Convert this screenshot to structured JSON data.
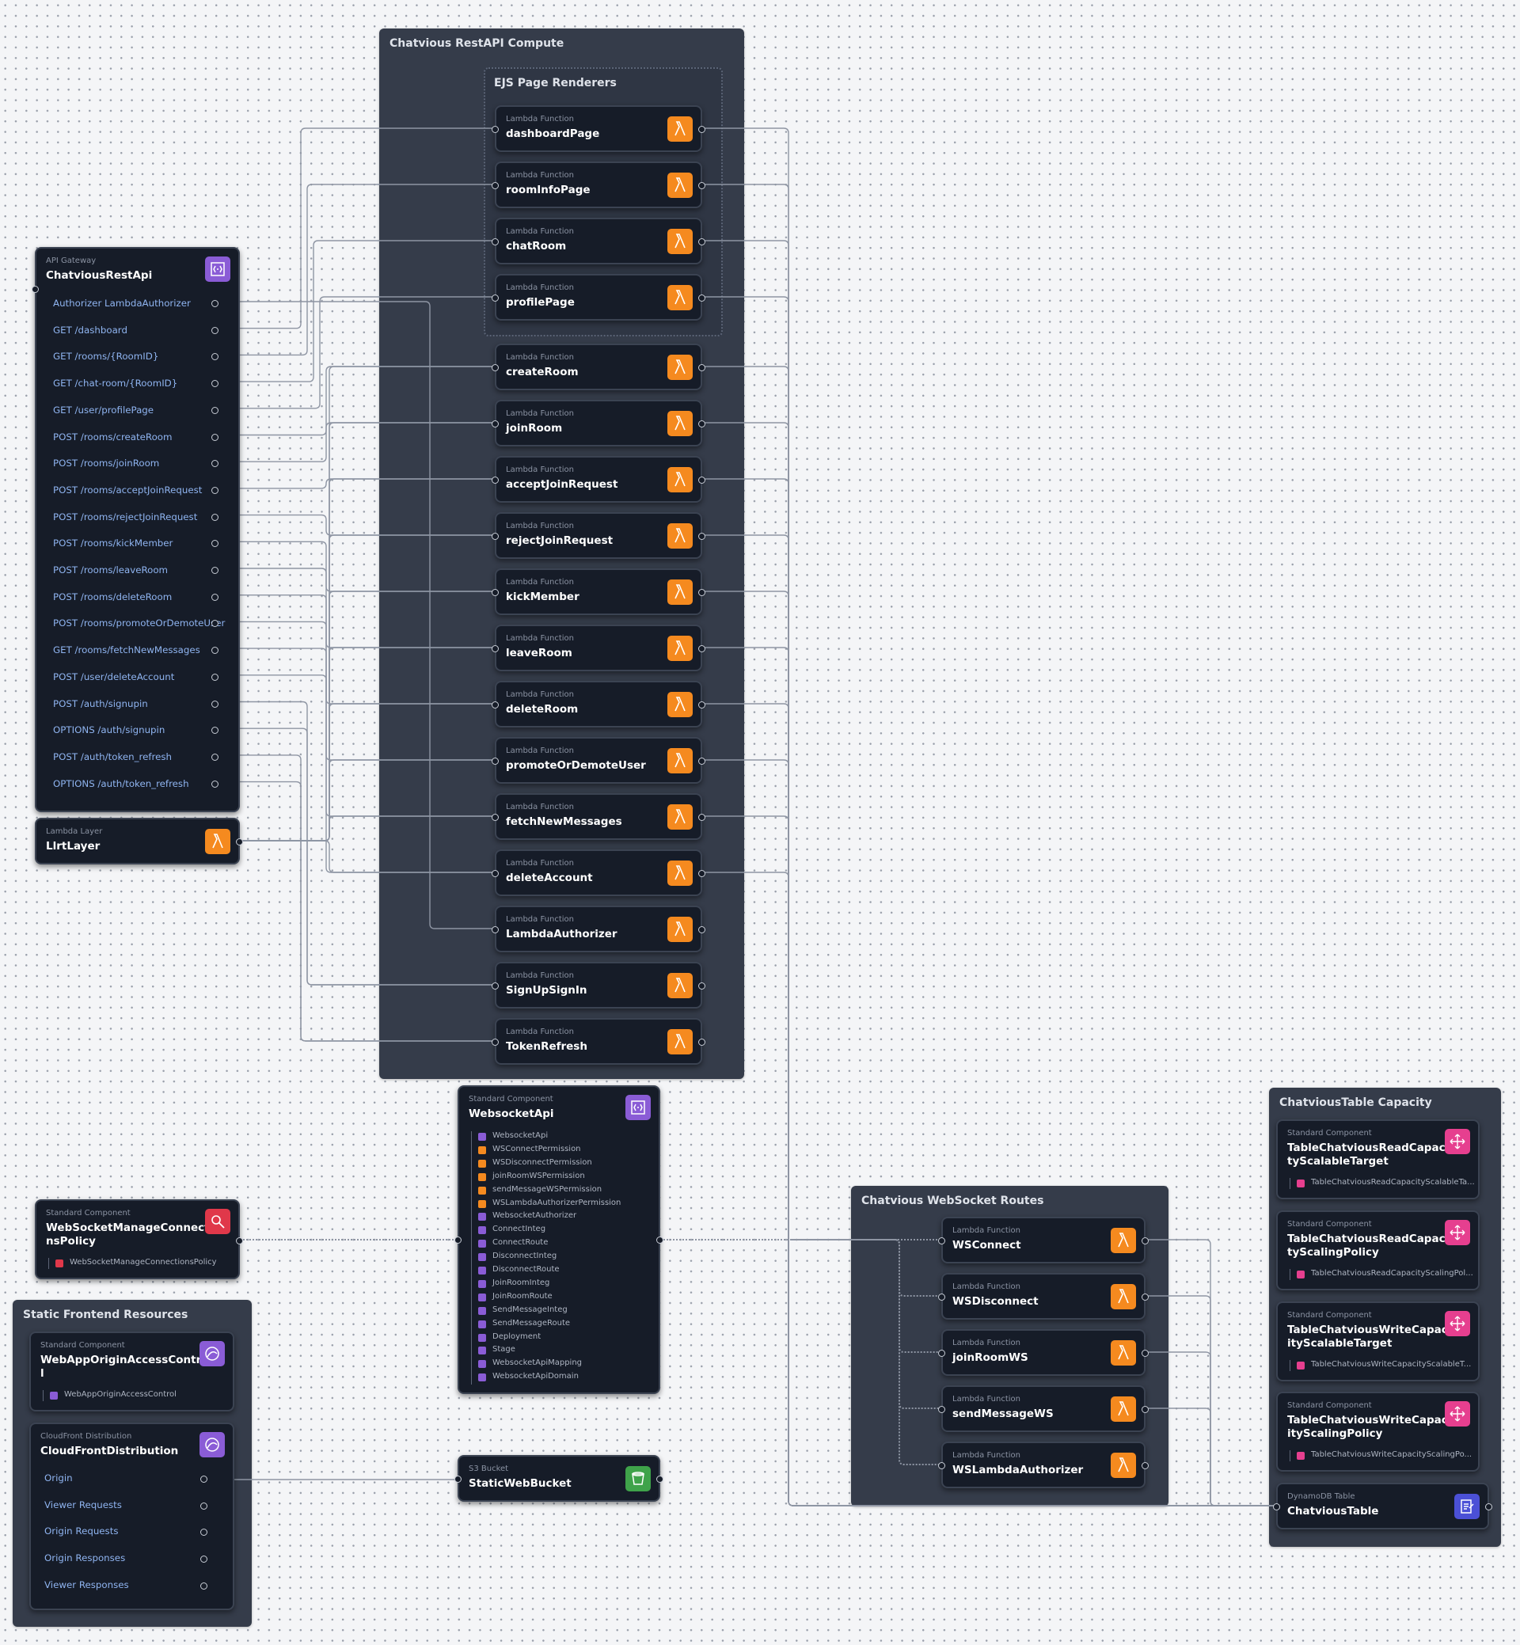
{
  "groups": {
    "restapi_compute": "Chatvious RestAPI Compute",
    "ejs_renderers": "EJS Page Renderers",
    "websocket_routes": "Chatvious WebSocket Routes",
    "table_capacity": "ChatviousTable Capacity",
    "static_frontend": "Static Frontend Resources"
  },
  "types": {
    "lambda_function": "Lambda Function",
    "api_gateway": "API Gateway",
    "lambda_layer": "Lambda Layer",
    "standard_component": "Standard Component",
    "cloudfront": "CloudFront Distribution",
    "s3_bucket": "S3 Bucket",
    "dynamodb": "DynamoDB Table"
  },
  "rest_api": {
    "name": "ChatviousRestApi",
    "routes": [
      "Authorizer LambdaAuthorizer",
      "GET /dashboard",
      "GET /rooms/{RoomID}",
      "GET /chat-room/{RoomID}",
      "GET /user/profilePage",
      "POST /rooms/createRoom",
      "POST /rooms/joinRoom",
      "POST /rooms/acceptJoinRequest",
      "POST /rooms/rejectJoinRequest",
      "POST /rooms/kickMember",
      "POST /rooms/leaveRoom",
      "POST /rooms/deleteRoom",
      "POST /rooms/promoteOrDemoteUser",
      "GET /rooms/fetchNewMessages",
      "POST /user/deleteAccount",
      "POST /auth/signupin",
      "OPTIONS /auth/signupin",
      "POST /auth/token_refresh",
      "OPTIONS /auth/token_refresh"
    ]
  },
  "lambda_layer": {
    "name": "LlrtLayer"
  },
  "ejs_functions": [
    "dashboardPage",
    "roomInfoPage",
    "chatRoom",
    "profilePage"
  ],
  "rest_functions": [
    "createRoom",
    "joinRoom",
    "acceptJoinRequest",
    "rejectJoinRequest",
    "kickMember",
    "leaveRoom",
    "deleteRoom",
    "promoteOrDemoteUser",
    "fetchNewMessages",
    "deleteAccount",
    "LambdaAuthorizer",
    "SignUpSignIn",
    "TokenRefresh"
  ],
  "websocket_api": {
    "name": "WebsocketApi",
    "items": [
      "WebsocketApi",
      "WSConnectPermission",
      "WSDisconnectPermission",
      "joinRoomWSPermission",
      "sendMessageWSPermission",
      "WSLambdaAuthorizerPermission",
      "WebsocketAuthorizer",
      "ConnectInteg",
      "ConnectRoute",
      "DisconnectInteg",
      "DisconnectRoute",
      "JoinRoomInteg",
      "JoinRoomRoute",
      "SendMessageInteg",
      "SendMessageRoute",
      "Deployment",
      "Stage",
      "WebsocketApiMapping",
      "WebsocketApiDomain"
    ],
    "item_kinds": [
      "apig",
      "lam",
      "lam",
      "lam",
      "lam",
      "lam",
      "apig",
      "apig",
      "apig",
      "apig",
      "apig",
      "apig",
      "apig",
      "apig",
      "apig",
      "apig",
      "apig",
      "apig",
      "apig"
    ]
  },
  "ws_manage_policy": {
    "name": "WebSocketManageConnectionsPolicy",
    "item": "WebSocketManageConnectionsPolicy"
  },
  "ws_functions": [
    "WSConnect",
    "WSDisconnect",
    "joinRoomWS",
    "sendMessageWS",
    "WSLambdaAuthorizer"
  ],
  "capacity": [
    {
      "name": "TableChatviousReadCapacityScalableTarget",
      "item": "TableChatviousReadCapacityScalableTa..."
    },
    {
      "name": "TableChatviousReadCapacityScalingPolicy",
      "item": "TableChatviousReadCapacityScalingPol..."
    },
    {
      "name": "TableChatviousWriteCapacityScalableTarget",
      "item": "TableChatviousWriteCapacityScalableT..."
    },
    {
      "name": "TableChatviousWriteCapacityScalingPolicy",
      "item": "TableChatviousWriteCapacityScalingPo..."
    }
  ],
  "dynamodb": {
    "name": "ChatviousTable"
  },
  "origin_access": {
    "name": "WebAppOriginAccessControl",
    "item": "WebAppOriginAccessControl"
  },
  "cloudfront": {
    "name": "CloudFrontDistribution",
    "items": [
      "Origin",
      "Viewer Requests",
      "Origin Requests",
      "Origin Responses",
      "Viewer Responses"
    ]
  },
  "s3": {
    "name": "StaticWebBucket"
  },
  "colors": {
    "lambda": "#f58a1f",
    "api_gateway": "#8a5cd6",
    "policy": "#e0384a",
    "autoscaling": "#e63f8f",
    "dynamodb": "#4b50d6",
    "s3": "#3fa34a",
    "route_text": "#8fb4f0",
    "group_bg": "#353c4a",
    "node_bg": "#161c28"
  },
  "icons": {
    "lambda": "lambda-icon",
    "api_gateway": "api-gateway-icon",
    "policy": "policy-icon",
    "autoscaling": "autoscaling-icon",
    "dynamodb": "dynamodb-icon",
    "s3": "bucket-icon",
    "cloudfront": "cloudfront-icon"
  }
}
